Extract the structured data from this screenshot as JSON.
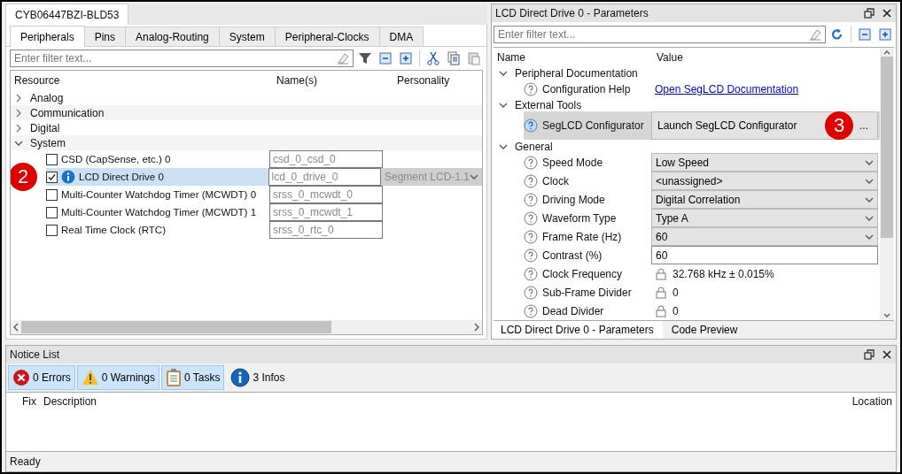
{
  "left_panel": {
    "document_tab": "CYB06447BZI-BLD53",
    "tabs": [
      {
        "label": "Peripherals",
        "selected": true
      },
      {
        "label": "Pins",
        "selected": false
      },
      {
        "label": "Analog-Routing",
        "selected": false
      },
      {
        "label": "System",
        "selected": false
      },
      {
        "label": "Peripheral-Clocks",
        "selected": false
      },
      {
        "label": "DMA",
        "selected": false
      }
    ],
    "filter": {
      "placeholder": "Enter filter text..."
    },
    "columns": [
      "Resource",
      "Name(s)",
      "Personality"
    ],
    "tree": [
      {
        "label": "Analog",
        "expanded": false
      },
      {
        "label": "Communication",
        "expanded": false
      },
      {
        "label": "Digital",
        "expanded": false
      },
      {
        "label": "System",
        "expanded": true,
        "children": [
          {
            "label": "CSD (CapSense, etc.) 0",
            "checked": false,
            "info": false,
            "name": "csd_0_csd_0",
            "selected": false
          },
          {
            "label": "LCD Direct Drive 0",
            "checked": true,
            "info": true,
            "name": "lcd_0_drive_0",
            "personality": "Segment LCD-1.1",
            "selected": true,
            "callout": "2"
          },
          {
            "label": "Multi-Counter Watchdog Timer (MCWDT) 0",
            "checked": false,
            "info": false,
            "name": "srss_0_mcwdt_0",
            "selected": false
          },
          {
            "label": "Multi-Counter Watchdog Timer (MCWDT) 1",
            "checked": false,
            "info": false,
            "name": "srss_0_mcwdt_1",
            "selected": false
          },
          {
            "label": "Real Time Clock (RTC)",
            "checked": false,
            "info": false,
            "name": "srss_0_rtc_0",
            "selected": false
          }
        ]
      }
    ]
  },
  "right_panel": {
    "title": "LCD Direct Drive 0 - Parameters",
    "filter": {
      "placeholder": "Enter filter text..."
    },
    "columns": [
      "Name",
      "Value"
    ],
    "groups": [
      {
        "label": "Peripheral Documentation",
        "expanded": true,
        "params": [
          {
            "name": "Configuration Help",
            "kind": "link",
            "value": "Open SegLCD Documentation"
          }
        ]
      },
      {
        "label": "External Tools",
        "expanded": true,
        "params": [
          {
            "name": "SegLCD Configurator",
            "kind": "launcher",
            "value": "Launch SegLCD Configurator",
            "button": "...",
            "selected": true,
            "callout": "3"
          }
        ]
      },
      {
        "label": "General",
        "expanded": true,
        "params": [
          {
            "name": "Speed Mode",
            "kind": "dropdown",
            "value": "Low Speed"
          },
          {
            "name": "Clock",
            "kind": "dropdown",
            "value": "<unassigned>"
          },
          {
            "name": "Driving Mode",
            "kind": "dropdown",
            "value": "Digital Correlation"
          },
          {
            "name": "Waveform Type",
            "kind": "dropdown",
            "value": "Type A"
          },
          {
            "name": "Frame Rate (Hz)",
            "kind": "dropdown",
            "value": "60"
          },
          {
            "name": "Contrast (%)",
            "kind": "text",
            "value": "60"
          },
          {
            "name": "Clock Frequency",
            "kind": "locked",
            "value": "32.768 kHz ± 0.015%"
          },
          {
            "name": "Sub-Frame Divider",
            "kind": "locked",
            "value": "0"
          },
          {
            "name": "Dead Divider",
            "kind": "locked",
            "value": "0"
          }
        ]
      }
    ],
    "bottom_tabs": [
      {
        "label": "LCD Direct Drive 0 - Parameters",
        "selected": true
      },
      {
        "label": "Code Preview",
        "selected": false
      }
    ]
  },
  "notice_list": {
    "title": "Notice List",
    "filters": [
      {
        "kind": "error",
        "label": "0 Errors",
        "on": true
      },
      {
        "kind": "warning",
        "label": "0 Warnings",
        "on": true
      },
      {
        "kind": "task",
        "label": "0 Tasks",
        "on": true
      },
      {
        "kind": "info",
        "label": "3 Infos",
        "on": false
      }
    ],
    "columns": [
      "Fix",
      "Description",
      "Location"
    ]
  },
  "status_bar": "Ready"
}
